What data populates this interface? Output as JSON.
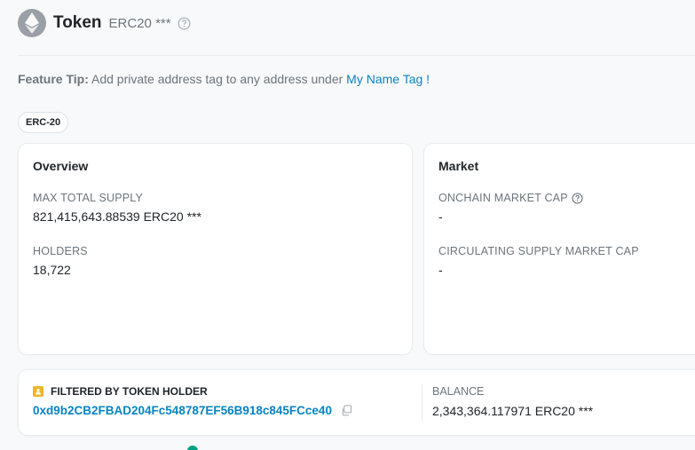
{
  "header": {
    "title": "Token",
    "subtitle": "ERC20 ***"
  },
  "tip": {
    "label": "Feature Tip:",
    "text": " Add private address tag to any address under ",
    "link": "My Name Tag !"
  },
  "badge": "ERC-20",
  "overview": {
    "title": "Overview",
    "max_supply_label": "MAX TOTAL SUPPLY",
    "max_supply_value": "821,415,643.88539 ERC20 ***",
    "holders_label": "HOLDERS",
    "holders_value": "18,722"
  },
  "market": {
    "title": "Market",
    "onchain_cap_label": "ONCHAIN MARKET CAP",
    "onchain_cap_value": "-",
    "circ_cap_label": "CIRCULATING SUPPLY MARKET CAP",
    "circ_cap_value": "-"
  },
  "filter": {
    "label": "FILTERED BY TOKEN HOLDER",
    "address": "0xd9b2CB2FBAD204Fc548787EF56B918c845FCce40",
    "balance_label": "BALANCE",
    "balance_value": "2,343,364.117971 ERC20 ***"
  },
  "colors": {
    "link": "#0784c3",
    "muted": "#6c757d",
    "holder_icon": "#f0b429",
    "status_dot": "#00a186"
  },
  "icons": [
    "ethereum-logo-icon",
    "help-circle-icon",
    "user-tag-icon",
    "copy-icon"
  ]
}
